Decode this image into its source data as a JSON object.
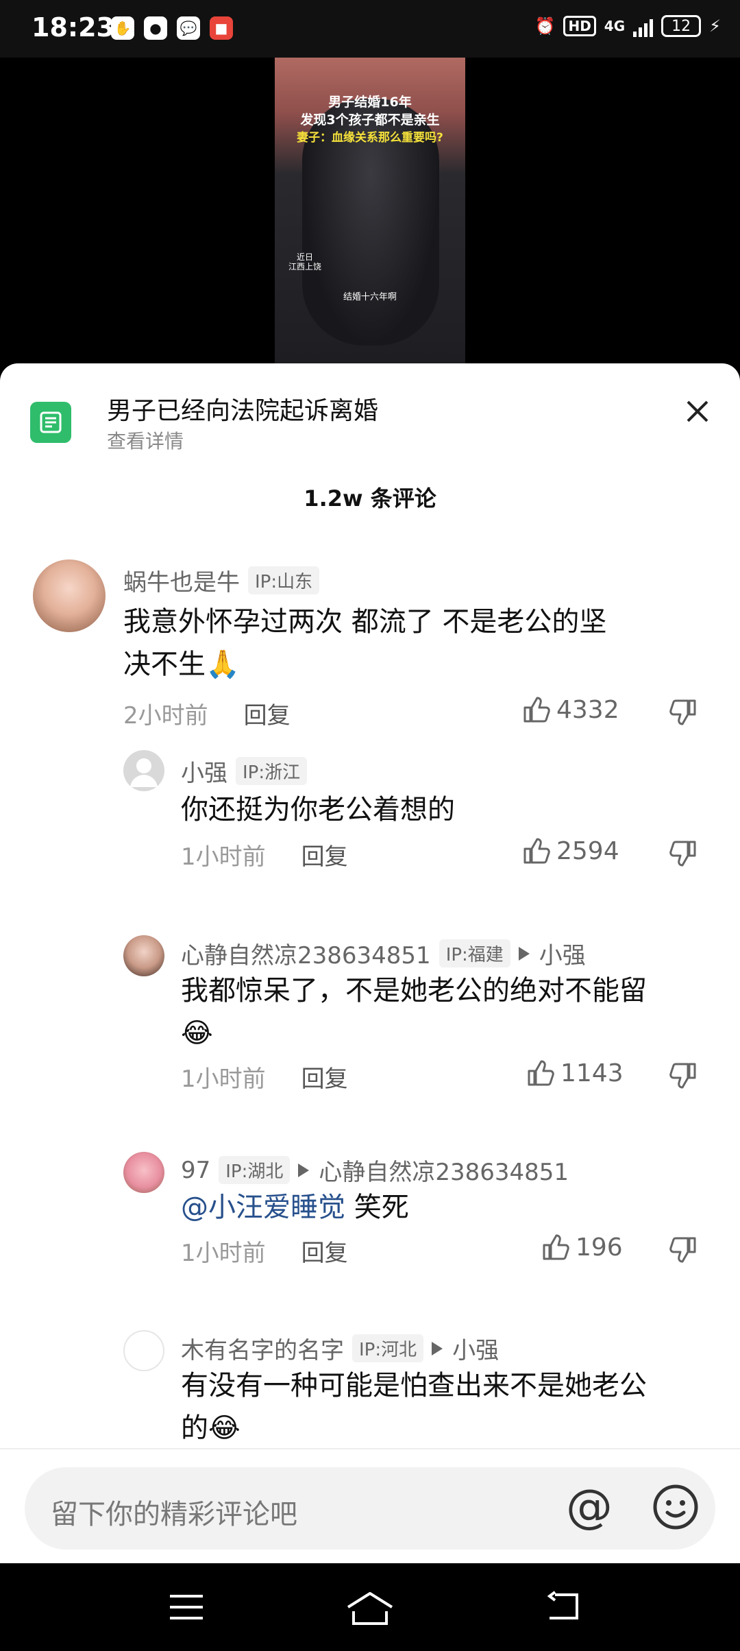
{
  "status_bar": {
    "time": "18:23",
    "network": "4G",
    "hd": "HD",
    "battery": "12"
  },
  "video": {
    "title_line1": "男子结婚16年",
    "title_line2": "发现3个孩子都不是亲生",
    "title_line3": "妻子：血缘关系那么重要吗?",
    "location_line1": "近日",
    "location_line2": "江西上饶",
    "subtitle": "结婚十六年啊"
  },
  "topic": {
    "title": "男子已经向法院起诉离婚",
    "subtitle": "查看详情"
  },
  "comment_count": "1.2w 条评论",
  "comments": [
    {
      "name": "蜗牛也是牛",
      "ip": "IP:山东",
      "body_line1": "我意外怀孕过两次  都流了  不是老公的坚",
      "body_line2": "决不生🙏",
      "time": "2小时前",
      "reply": "回复",
      "likes": "4332"
    },
    {
      "name": "小强",
      "ip": "IP:浙江",
      "body_line1": "你还挺为你老公着想的",
      "time": "1小时前",
      "reply": "回复",
      "likes": "2594"
    },
    {
      "name": "心静自然凉238634851",
      "ip": "IP:福建",
      "reply_to": "小强",
      "body_line1": "我都惊呆了，不是她老公的绝对不能留",
      "body_line2": "😂",
      "time": "1小时前",
      "reply": "回复",
      "likes": "1143"
    },
    {
      "name": "97",
      "ip": "IP:湖北",
      "reply_to": "心静自然凉238634851",
      "mention": "@小汪爱睡觉",
      "body_line1": " 笑死",
      "time": "1小时前",
      "reply": "回复",
      "likes": "196"
    },
    {
      "name": "木有名字的名字",
      "ip": "IP:河北",
      "reply_to": "小强",
      "body_line1": "有没有一种可能是怕查出来不是她老公",
      "body_line2": "的😂"
    }
  ],
  "input": {
    "placeholder": "留下你的精彩评论吧",
    "at_label": "@"
  }
}
